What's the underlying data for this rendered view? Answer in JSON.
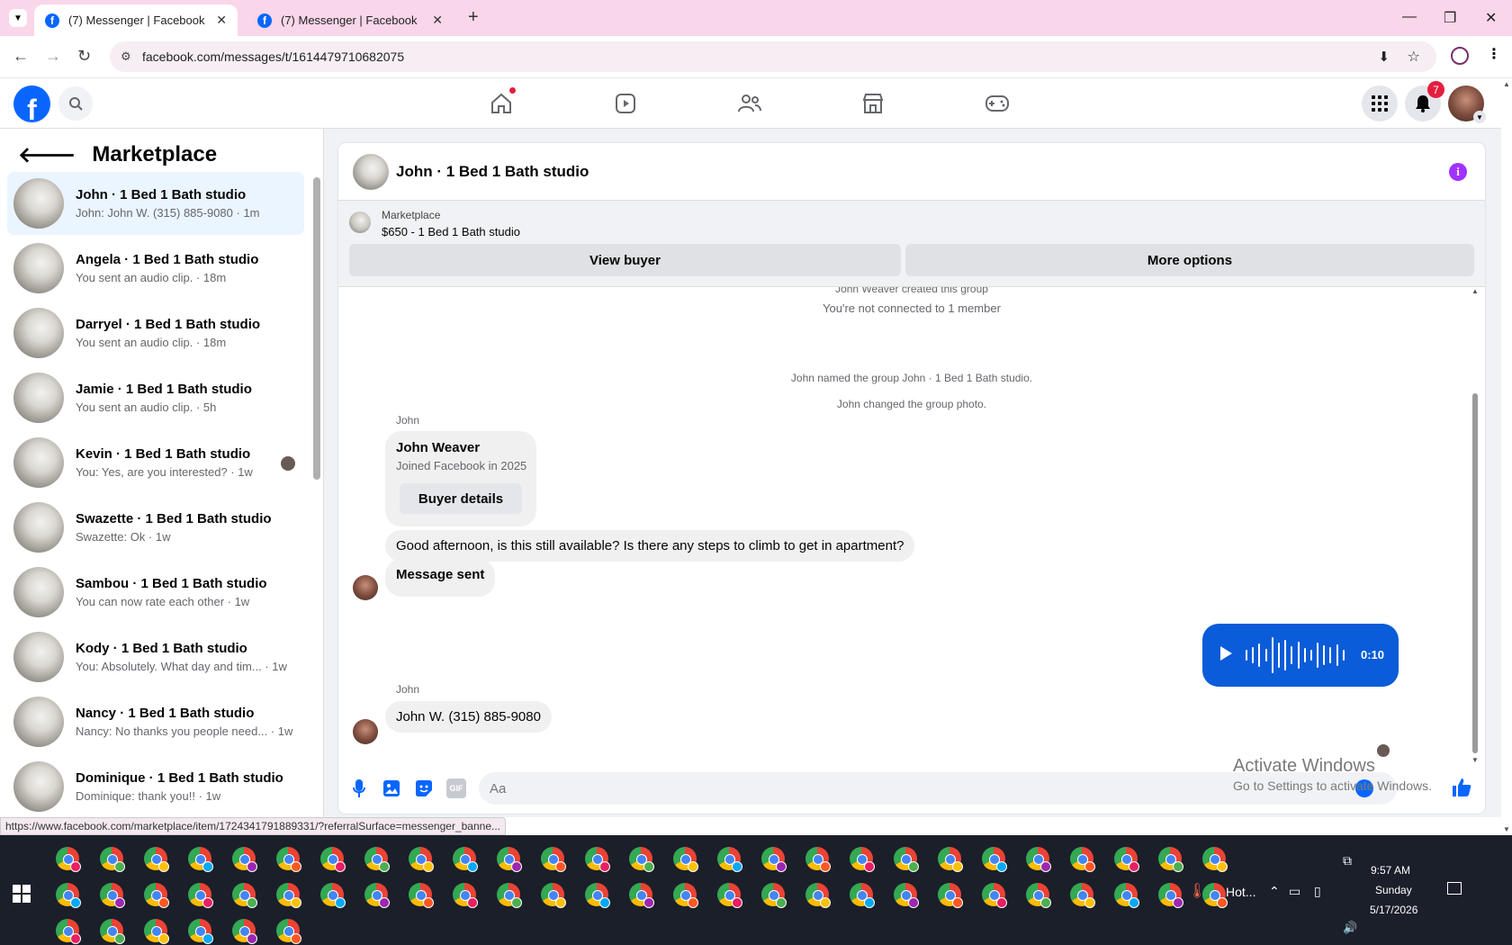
{
  "browser": {
    "tabs": [
      {
        "title": "(7) Messenger | Facebook",
        "active": true
      },
      {
        "title": "(7) Messenger | Facebook",
        "active": false
      }
    ],
    "url": "facebook.com/messages/t/1614479710682075",
    "status_url": "https://www.facebook.com/marketplace/item/1724341791889331/?referralSurface=messenger_banne..."
  },
  "fb_header": {
    "logo": "f",
    "notifications_count": "7"
  },
  "sidebar": {
    "title": "Marketplace",
    "conversations": [
      {
        "name": "John · 1 Bed 1 Bath studio",
        "preview": "John: John W. (315) 885-9080 · 1m",
        "selected": true
      },
      {
        "name": "Angela · 1 Bed 1 Bath studio",
        "preview": "You sent an audio clip. · 18m"
      },
      {
        "name": "Darryel · 1 Bed 1 Bath studio",
        "preview": "You sent an audio clip. · 18m"
      },
      {
        "name": "Jamie · 1 Bed 1 Bath studio",
        "preview": "You sent an audio clip. · 5h"
      },
      {
        "name": "Kevin · 1 Bed 1 Bath studio",
        "preview": "You: Yes, are you interested? · 1w"
      },
      {
        "name": "Swazette · 1 Bed 1 Bath studio",
        "preview": "Swazette: Ok · 1w"
      },
      {
        "name": "Sambou · 1 Bed 1 Bath studio",
        "preview": "You can now rate each other · 1w"
      },
      {
        "name": "Kody · 1 Bed 1 Bath studio",
        "preview": "You: Absolutely. What day and tim... · 1w"
      },
      {
        "name": "Nancy · 1 Bed 1 Bath studio",
        "preview": "Nancy: No thanks you people need... · 1w"
      },
      {
        "name": "Dominique · 1 Bed 1 Bath studio",
        "preview": "Dominique: thank you!! · 1w"
      }
    ]
  },
  "chat": {
    "title": "John · 1 Bed 1 Bath studio",
    "marketplace_label": "Marketplace",
    "listing": "$650 - 1 Bed 1 Bath studio",
    "view_buyer": "View buyer",
    "more_options": "More options",
    "system_messages": [
      "John Weaver created this group",
      "You're not connected to 1 member",
      "John named the group John · 1 Bed 1 Bath studio.",
      "John changed the group photo."
    ],
    "sender_name": "John",
    "buyer_card": {
      "name": "John Weaver",
      "joined": "Joined Facebook in 2025",
      "button": "Buyer details"
    },
    "msg_question": "Good afternoon, is this still available? Is there any steps to climb to get in apartment?",
    "msg_sent": "Message sent",
    "audio_duration": "0:10",
    "msg_phone": "John W. (315) 885-9080",
    "input_placeholder": "Aa"
  },
  "watermark": {
    "line1": "Activate Windows",
    "line2": "Go to Settings to activate Windows."
  },
  "taskbar": {
    "weather": "Hot...",
    "time": "9:57 AM",
    "day": "Sunday",
    "date": "5/17/2026"
  }
}
